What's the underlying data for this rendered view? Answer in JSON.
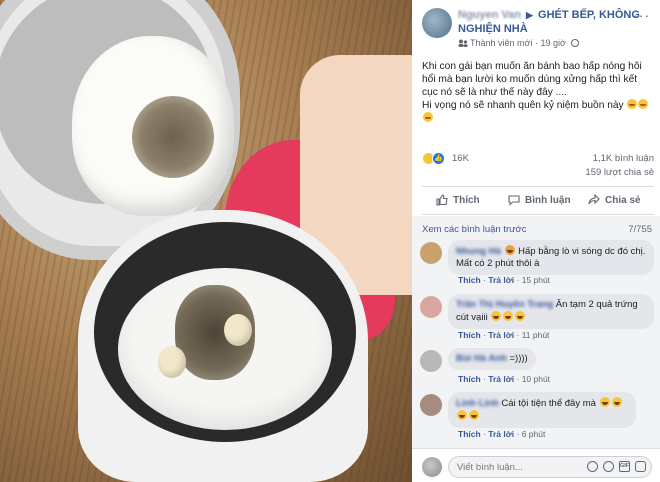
{
  "post": {
    "author": "Nguyen Van",
    "group": "GHÉT BẾP, KHÔNG NGHIỆN NHÀ",
    "badge": "Thành viên mới",
    "time": "19 giờ",
    "text": "Khi con gái bạn muốn ăn bánh bao hấp nóng hôi hổi mà bạn lười ko muốn dùng xửng hấp thì kết cục nó sẽ là như thế này đây ....",
    "text2": "Hi vọng nó sẽ nhanh quên kỷ niệm buồn này",
    "reactions": "16K",
    "comments_count": "1,1K bình luận",
    "shares_count": "159 lượt chia sẻ"
  },
  "actions": {
    "like": "Thích",
    "comment": "Bình luận",
    "share": "Chia sẻ"
  },
  "thread": {
    "view_previous": "Xem các bình luận trước",
    "count": "7/755",
    "comments": [
      {
        "name": "Nhung Hà",
        "text": "Hấp bằng lò vi sóng dc đó chị. Mất có 2 phút thôi à",
        "time": "15 phút",
        "avatar_color": "#c7a26b"
      },
      {
        "name": "Trần Thị Huyền Trang",
        "text": "Ăn tạm 2 quả trứng cút vạiii",
        "time": "11 phút",
        "avatar_color": "#d9a7a0"
      },
      {
        "name": "Bùi Hà Anh",
        "text": "=))))",
        "time": "10 phút",
        "avatar_color": "#b8b8b8"
      },
      {
        "name": "Linh Linh",
        "text": "Cái tội tiện thể đây mà",
        "time": "6 phút",
        "avatar_color": "#a58c7e"
      }
    ],
    "like_label": "Thích",
    "reply_label": "Trả lời"
  },
  "composer": {
    "placeholder": "Viết bình luận..."
  },
  "colors": {
    "link": "#385898",
    "bubble": "#e4e6eb",
    "like_blue": "#1877f2",
    "text": "#1c1e21",
    "muted": "#606770"
  },
  "icons": [
    "more-icon",
    "globe-icon",
    "like-icon",
    "comment-icon",
    "share-icon",
    "emoji-icon",
    "camera-icon",
    "gif-icon",
    "sticker-icon"
  ]
}
